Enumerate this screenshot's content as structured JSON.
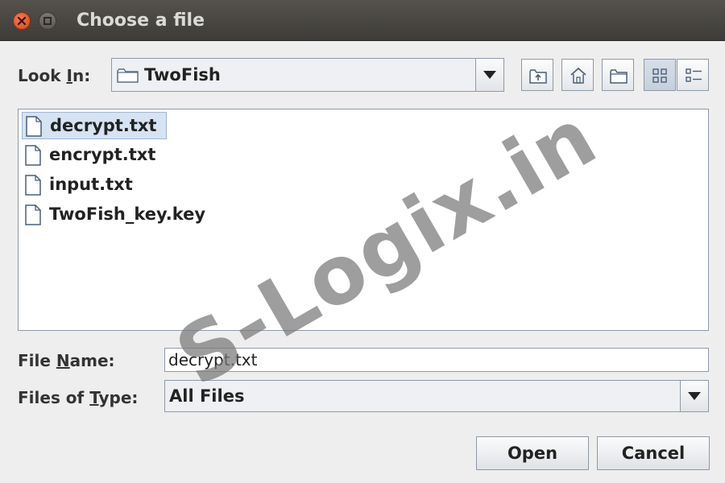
{
  "window": {
    "title": "Choose a file"
  },
  "look_in": {
    "label_pre": "Look ",
    "label_ul": "I",
    "label_post": "n:",
    "value": "TwoFish"
  },
  "toolbar": {
    "up_icon": "up-one-level-icon",
    "home_icon": "home-icon",
    "new_folder_icon": "new-folder-icon",
    "list_icon": "list-view-icon",
    "details_icon": "details-view-icon"
  },
  "files": [
    {
      "name": "decrypt.txt",
      "selected": true
    },
    {
      "name": "encrypt.txt",
      "selected": false
    },
    {
      "name": "input.txt",
      "selected": false
    },
    {
      "name": "TwoFish_key.key",
      "selected": false
    }
  ],
  "file_name": {
    "label_pre": "File ",
    "label_ul": "N",
    "label_post": "ame:",
    "value": "decrypt.txt"
  },
  "file_type": {
    "label_pre": "Files of ",
    "label_ul": "T",
    "label_post": "ype:",
    "value": "All Files"
  },
  "buttons": {
    "open": "Open",
    "cancel": "Cancel"
  },
  "watermark": "S-Logix.in"
}
